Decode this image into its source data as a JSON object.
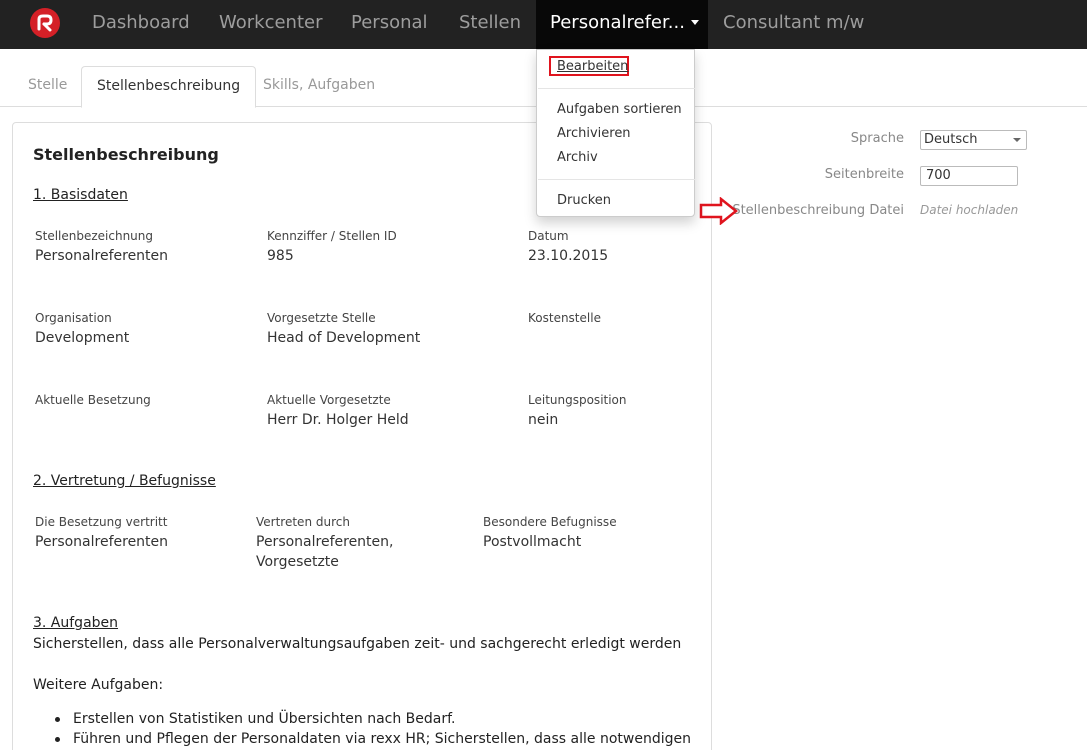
{
  "nav": {
    "items": [
      {
        "label": "Dashboard"
      },
      {
        "label": "Workcenter"
      },
      {
        "label": "Personal"
      },
      {
        "label": "Stellen"
      },
      {
        "label": "Personalrefer..."
      },
      {
        "label": "Consultant m/w"
      }
    ],
    "active_index": 4
  },
  "tabs": [
    {
      "label": "Stelle"
    },
    {
      "label": "Stellenbeschreibung"
    },
    {
      "label": "Skills, Aufgaben"
    }
  ],
  "dropdown": {
    "items": [
      "Bearbeiten",
      "Aufgaben sortieren",
      "Archivieren",
      "Archiv",
      "Drucken"
    ],
    "highlight_color": "#e0141e"
  },
  "doc": {
    "title": "Stellenbeschreibung",
    "section1": {
      "heading": "1. Basisdaten",
      "fields": [
        {
          "label": "Stellenbezeichnung",
          "value": "Personalreferenten"
        },
        {
          "label": "Kennziffer / Stellen ID",
          "value": "985"
        },
        {
          "label": "Datum",
          "value": "23.10.2015"
        },
        {
          "label": "Organisation",
          "value": "Development"
        },
        {
          "label": "Vorgesetzte Stelle",
          "value": "Head of Development"
        },
        {
          "label": "Kostenstelle",
          "value": ""
        },
        {
          "label": "Aktuelle Besetzung",
          "value": ""
        },
        {
          "label": "Aktuelle Vorgesetzte",
          "value": "Herr Dr. Holger Held"
        },
        {
          "label": "Leitungsposition",
          "value": "nein"
        }
      ]
    },
    "section2": {
      "heading": "2. Vertretung / Befugnisse",
      "fields": [
        {
          "label": "Die Besetzung vertritt",
          "value": "Personalreferenten",
          "value2": ""
        },
        {
          "label": "Vertreten durch",
          "value": "Personalreferenten,",
          "value2": "Vorgesetzte"
        },
        {
          "label": "Besondere Befugnisse",
          "value": "Postvollmacht",
          "value2": ""
        }
      ]
    },
    "section3": {
      "heading": "3. Aufgaben",
      "main": "Sicherstellen, dass alle Personalverwaltungsaufgaben zeit- und sachgerecht erledigt werden",
      "further": "Weitere Aufgaben:",
      "bullets": [
        "Erstellen von Statistiken und Übersichten nach Bedarf.",
        "Führen und Pflegen der Personaldaten via rexx HR; Sicherstellen, dass alle notwendigen"
      ]
    }
  },
  "settings": {
    "language_label": "Sprache",
    "language_value": "Deutsch",
    "width_label": "Seitenbreite",
    "width_value": "700",
    "file_label": "Stellenbeschreibung Datei",
    "file_action": "Datei hochladen"
  },
  "colors": {
    "topbar": "#222222",
    "active_nav": "#080808",
    "brand": "#d42027",
    "annotation": "#e0141e"
  }
}
